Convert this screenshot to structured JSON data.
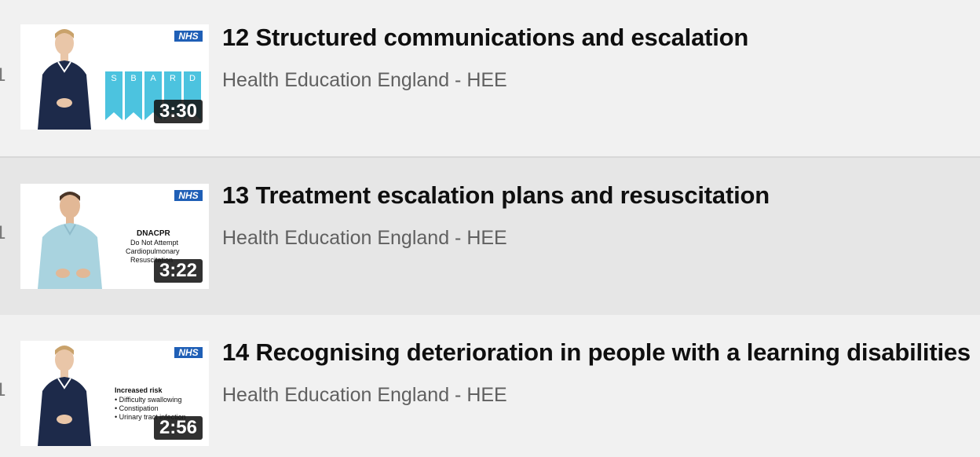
{
  "videos": [
    {
      "index": "12",
      "title": "12 Structured communications and escalation",
      "channel": "Health Education England - HEE",
      "duration": "3:30",
      "thumb_badge": "NHS",
      "thumb_letters": [
        "S",
        "B",
        "A",
        "R",
        "D"
      ]
    },
    {
      "index": "13",
      "title": "13 Treatment escalation plans and resuscitation",
      "channel": "Health Education England - HEE",
      "duration": "3:22",
      "thumb_badge": "NHS",
      "thumb_text": [
        "DNACPR",
        "Do Not Attempt",
        "Cardiopulmonary",
        "Resuscitation"
      ]
    },
    {
      "index": "14",
      "title": "14 Recognising deterioration in people with a learning disabilities",
      "channel": "Health Education England - HEE",
      "duration": "2:56",
      "thumb_badge": "NHS",
      "thumb_text": [
        "Increased risk",
        "• Difficulty swallowing",
        "• Constipation",
        "• Urinary tract infection"
      ]
    }
  ],
  "colors": {
    "selected_row": "#e6e6e6",
    "background": "#f1f1f1",
    "nhs_blue": "#1f5fb6",
    "sbard_teal": "#4cc3df"
  }
}
